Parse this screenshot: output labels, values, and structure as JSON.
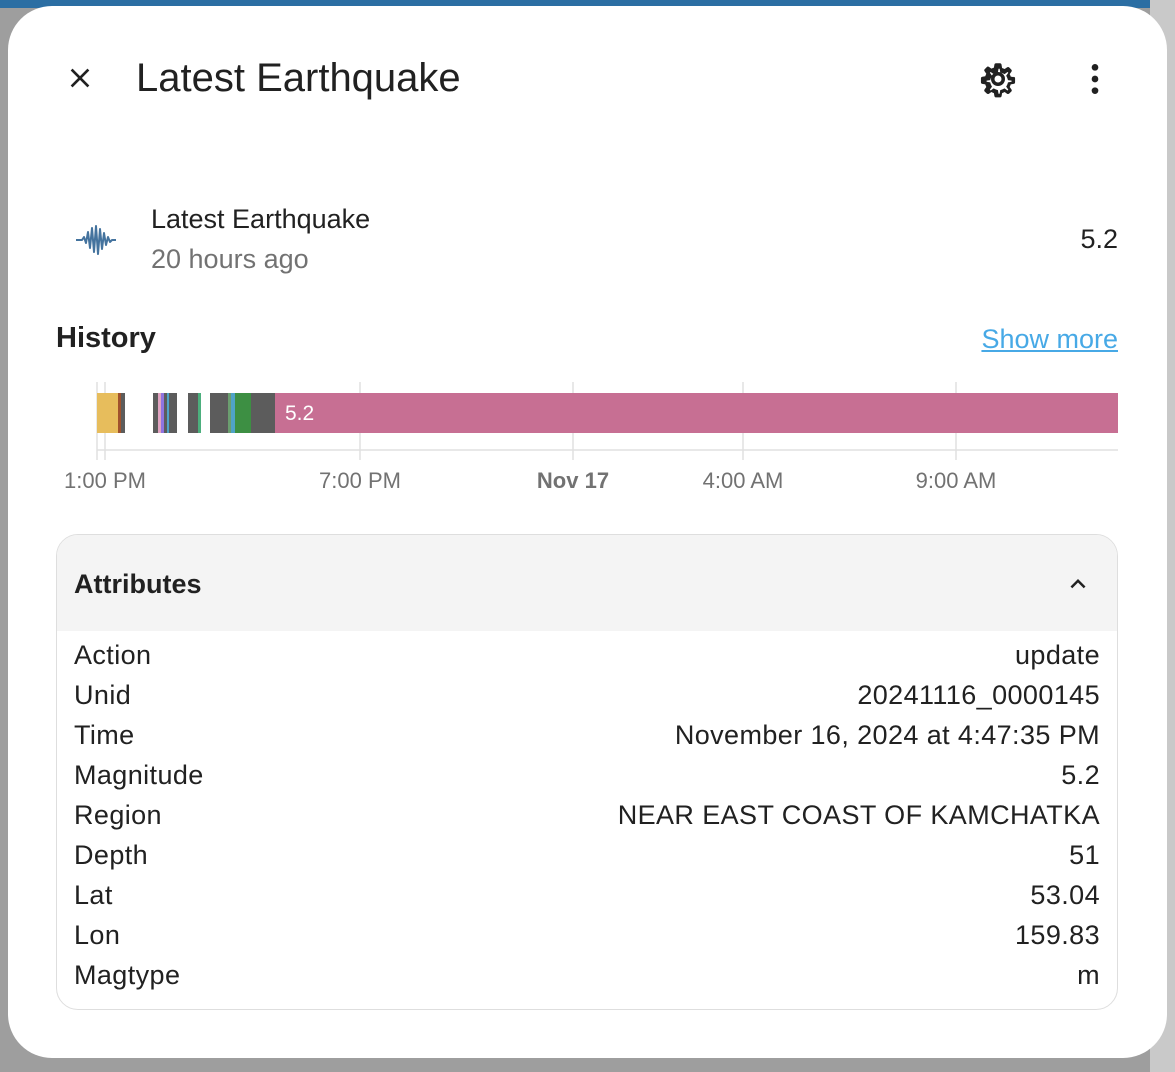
{
  "dialog": {
    "title": "Latest Earthquake",
    "close_icon": "close-icon",
    "settings_icon": "gear-icon",
    "more_icon": "more-vertical-icon"
  },
  "entity": {
    "icon": "seismic-wave-icon",
    "name": "Latest Earthquake",
    "last_changed": "20 hours ago",
    "state": "5.2"
  },
  "history": {
    "title": "History",
    "show_more": "Show more",
    "bar_label": "5.2",
    "ticks": [
      "1:00 PM",
      "7:00 PM",
      "Nov 17",
      "4:00 AM",
      "9:00 AM"
    ],
    "colors": {
      "main": "#c76f93",
      "gray": "#5c5c5c",
      "yellow": "#e7bd5c",
      "green": "#3d8f43"
    }
  },
  "attributes": {
    "title": "Attributes",
    "toggle_icon": "chevron-up-icon",
    "rows": [
      {
        "key": "Action",
        "value": "update"
      },
      {
        "key": "Unid",
        "value": "20241116_0000145"
      },
      {
        "key": "Time",
        "value": "November 16, 2024 at 4:47:35 PM"
      },
      {
        "key": "Magnitude",
        "value": "5.2"
      },
      {
        "key": "Region",
        "value": "NEAR EAST COAST OF KAMCHATKA"
      },
      {
        "key": "Depth",
        "value": "51"
      },
      {
        "key": "Lat",
        "value": "53.04"
      },
      {
        "key": "Lon",
        "value": "159.83"
      },
      {
        "key": "Magtype",
        "value": "m"
      }
    ]
  }
}
